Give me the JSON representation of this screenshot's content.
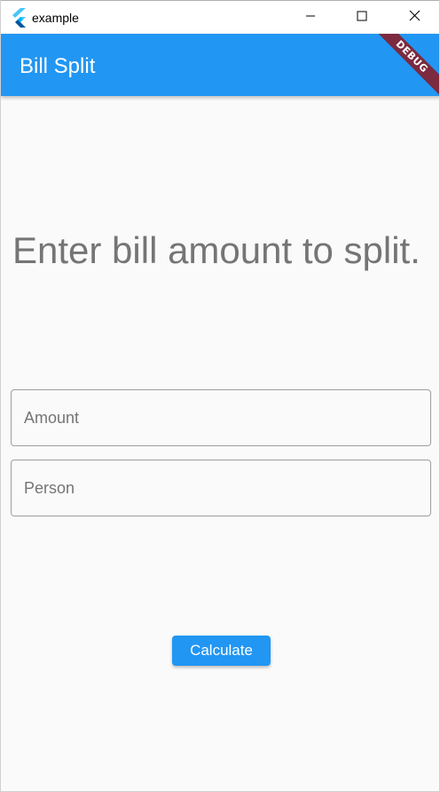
{
  "window": {
    "title": "example",
    "icon": "flutter-logo-icon",
    "controls": {
      "minimize_icon": "minimize-icon",
      "maximize_icon": "maximize-icon",
      "close_icon": "close-icon"
    }
  },
  "appbar": {
    "title": "Bill Split",
    "debug_banner": "DEBUG"
  },
  "main": {
    "prompt": "Enter bill amount to split.",
    "amount_placeholder": "Amount",
    "person_placeholder": "Person",
    "calculate_label": "Calculate"
  },
  "colors": {
    "primary": "#2196f3",
    "background": "#fafafa",
    "prompt_text": "#757575",
    "debug_banner": "#7b2a3f"
  }
}
